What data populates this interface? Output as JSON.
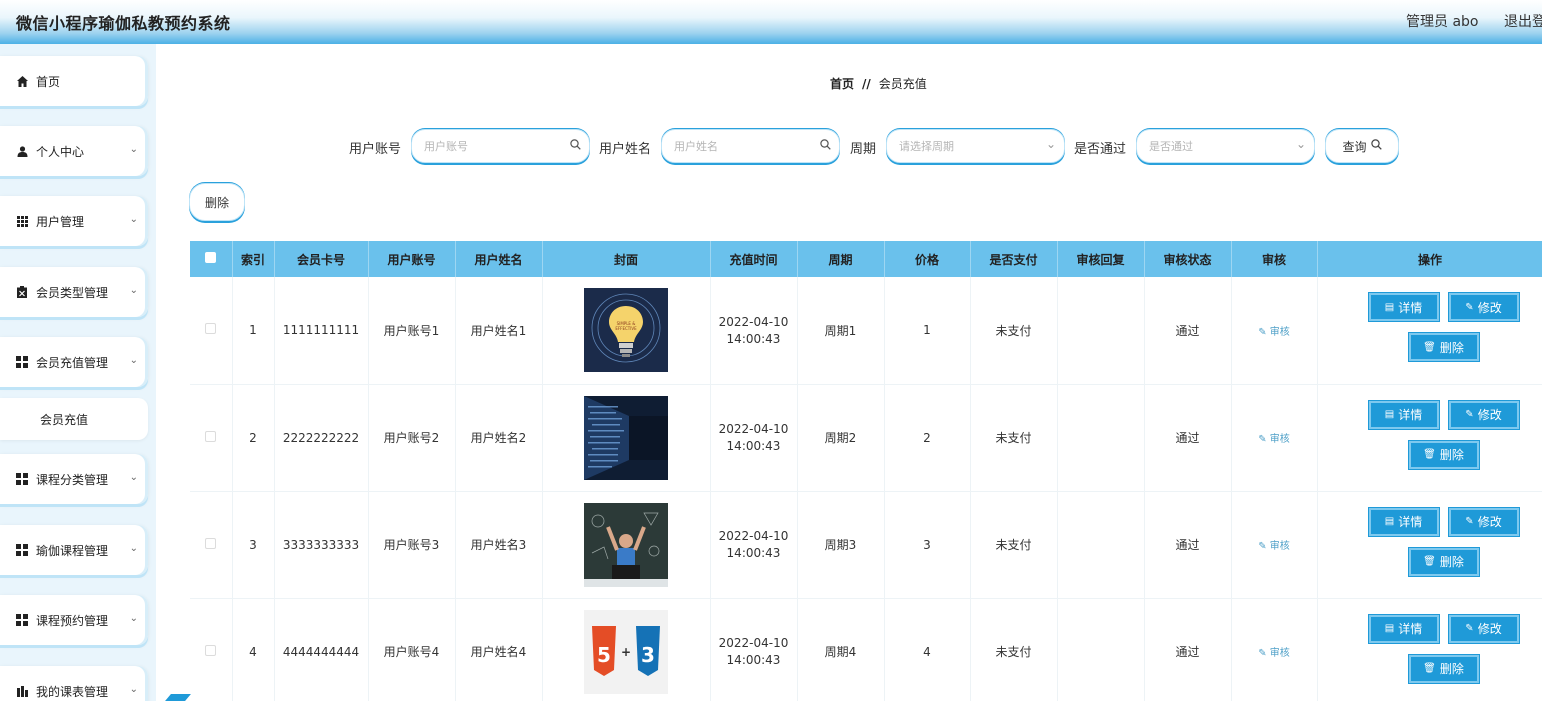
{
  "header": {
    "title": "微信小程序瑜伽私教预约系统",
    "user_label": "管理员 abo",
    "logout_label": "退出登录"
  },
  "sidebar": {
    "items": [
      {
        "label": "首页",
        "icon": "home-icon"
      },
      {
        "label": "个人中心",
        "icon": "user-icon"
      },
      {
        "label": "用户管理",
        "icon": "grid-icon"
      },
      {
        "label": "会员类型管理",
        "icon": "clipboard-icon"
      },
      {
        "label": "会员充值管理",
        "icon": "grid-icon"
      },
      {
        "label": "课程分类管理",
        "icon": "grid-icon"
      },
      {
        "label": "瑜伽课程管理",
        "icon": "grid-icon"
      },
      {
        "label": "课程预约管理",
        "icon": "grid-icon"
      },
      {
        "label": "我的课表管理",
        "icon": "chart-icon"
      }
    ],
    "sub_item": "会员充值"
  },
  "breadcrumb": {
    "home": "首页",
    "separator": "//",
    "current": "会员充值"
  },
  "search": {
    "account_label": "用户账号",
    "account_placeholder": "用户账号",
    "name_label": "用户姓名",
    "name_placeholder": "用户姓名",
    "period_label": "周期",
    "period_placeholder": "请选择周期",
    "pass_label": "是否通过",
    "pass_placeholder": "是否通过",
    "query_label": "查询"
  },
  "toolbar": {
    "delete_label": "删除"
  },
  "table": {
    "headers": [
      "索引",
      "会员卡号",
      "用户账号",
      "用户姓名",
      "封面",
      "充值时间",
      "周期",
      "价格",
      "是否支付",
      "审核回复",
      "审核状态",
      "审核",
      "操作"
    ],
    "rows": [
      {
        "index": "1",
        "card": "1111111111",
        "account": "用户账号1",
        "name": "用户姓名1",
        "cover": "lightbulb-image",
        "date": "2022-04-10",
        "time": "14:00:43",
        "period": "周期1",
        "price": "1",
        "paid": "未支付",
        "reply": "",
        "status": "通过",
        "audit": "审核"
      },
      {
        "index": "2",
        "card": "2222222222",
        "account": "用户账号2",
        "name": "用户姓名2",
        "cover": "code-image",
        "date": "2022-04-10",
        "time": "14:00:43",
        "period": "周期2",
        "price": "2",
        "paid": "未支付",
        "reply": "",
        "status": "通过",
        "audit": "审核"
      },
      {
        "index": "3",
        "card": "3333333333",
        "account": "用户账号3",
        "name": "用户姓名3",
        "cover": "blackboard-image",
        "date": "2022-04-10",
        "time": "14:00:43",
        "period": "周期3",
        "price": "3",
        "paid": "未支付",
        "reply": "",
        "status": "通过",
        "audit": "审核"
      },
      {
        "index": "4",
        "card": "4444444444",
        "account": "用户账号4",
        "name": "用户姓名4",
        "cover": "html5-css3-image",
        "date": "2022-04-10",
        "time": "14:00:43",
        "period": "周期4",
        "price": "4",
        "paid": "未支付",
        "reply": "",
        "status": "通过",
        "audit": "审核"
      }
    ],
    "actions": {
      "detail": "详情",
      "edit": "修改",
      "delete": "删除"
    }
  },
  "colors": {
    "accent": "#1f9ad8",
    "header_blue": "#4bb0e6",
    "table_header": "#6ac1ec"
  }
}
